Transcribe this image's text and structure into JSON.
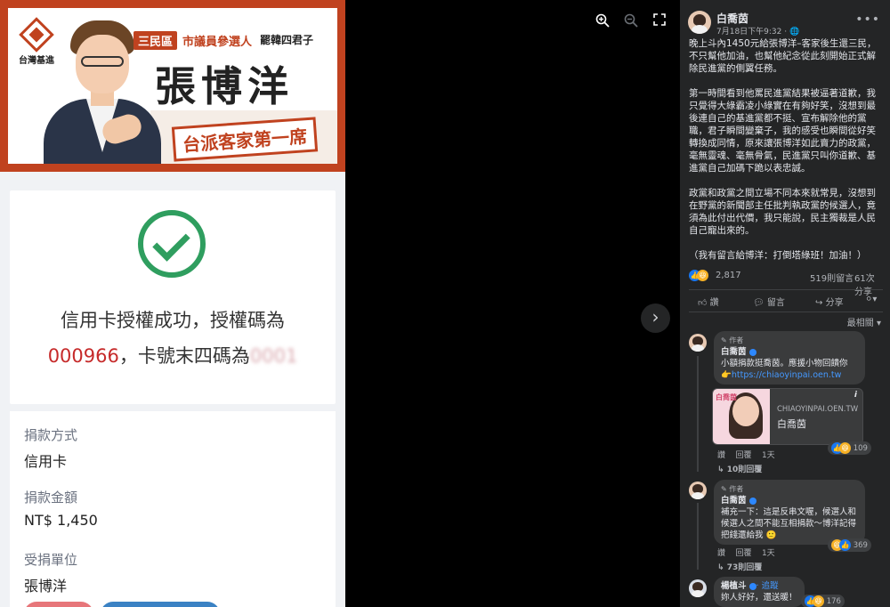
{
  "banner": {
    "logo_text": "台灣基進",
    "district": "三民區",
    "role": "市議員參選人",
    "slogan": "罷韓四君子",
    "candidate_name": "張博洋",
    "tagline": "台派客家第一席"
  },
  "receipt": {
    "success_line1": "信用卡授權成功，授權碼為",
    "auth_code": "000966",
    "success_mid": "，卡號末四碼為",
    "card_last4_masked": "0001",
    "fields": [
      {
        "label": "捐款方式",
        "value": "信用卡"
      },
      {
        "label": "捐款金額",
        "value": "NT$ 1,450"
      },
      {
        "label": "受捐單位",
        "value": "張博洋"
      }
    ]
  },
  "viewer_tools": {
    "zoom_in": "zoom-in-icon",
    "zoom_out": "zoom-out-icon",
    "fullscreen": "fullscreen-icon",
    "next": "chevron-right-icon"
  },
  "post": {
    "author": "白喬茵",
    "time": "7月18日下午9:32",
    "paragraphs": [
      "晚上斗內1450元給張博洋–客家後生還三民，不只幫他加油，也幫他紀念從此刻開始正式解除民進黨的側翼任務。",
      "第一時間看到他罵民進黨結果被逼著道歉，我只覺得大綠霸凌小綠實在有夠好笑，沒想到最後連自己的基進黨都不挺、宣布解除他的黨職，君子瞬間變棄子，我的感受也瞬間從好笑轉換成同情，原來讓張博洋如此賣力的政黨，毫無靈魂、毫無骨氣，民進黨只叫你道歉、基進黨自己加碼下跪以表忠誠。",
      "政黨和政黨之間立場不同本來就常見，沒想到在野黨的新聞部主任批判執政黨的候選人，竟須為此付出代價，我只能說，民主獨裁是人民自己寵出來的。",
      "（我有留言給博洋：打倒塔綠班！加油！）"
    ],
    "reaction_count": "2,817",
    "comment_count": "519則留言",
    "share_count": "61次分享",
    "actions": [
      "讚",
      "留言",
      "分享"
    ],
    "sort_label": "最相關"
  },
  "comments": [
    {
      "badge": "作者",
      "name": "白喬茵",
      "text": "小額捐款挺喬茵。應援小物回饋你",
      "link": "https://chiaoyinpai.oen.tw",
      "link_card": {
        "domain": "CHIAOYINPAI.OEN.TW",
        "title": "白喬茵",
        "thumb_tag": "白喬茵"
      },
      "like": "讚",
      "reply": "回覆",
      "age": "1天",
      "reactions": "109",
      "replies": "10則回覆"
    },
    {
      "badge": "作者",
      "name": "白喬茵",
      "text": "補充一下：這是反串文喔，候選人和候選人之間不能互相捐款～博洋記得把錢還給我",
      "like": "讚",
      "reply": "回覆",
      "age": "1天",
      "reactions": "369",
      "replies": "73則回覆"
    },
    {
      "name": "楊植斗",
      "follow": "· 追蹤",
      "text": "妳人好好，還送暖！",
      "reactions": "176"
    }
  ],
  "colors": {
    "accent_red": "#c0421f",
    "success_green": "#2f9e5f",
    "fb_dark": "#242526",
    "fb_blue": "#1877f2"
  }
}
